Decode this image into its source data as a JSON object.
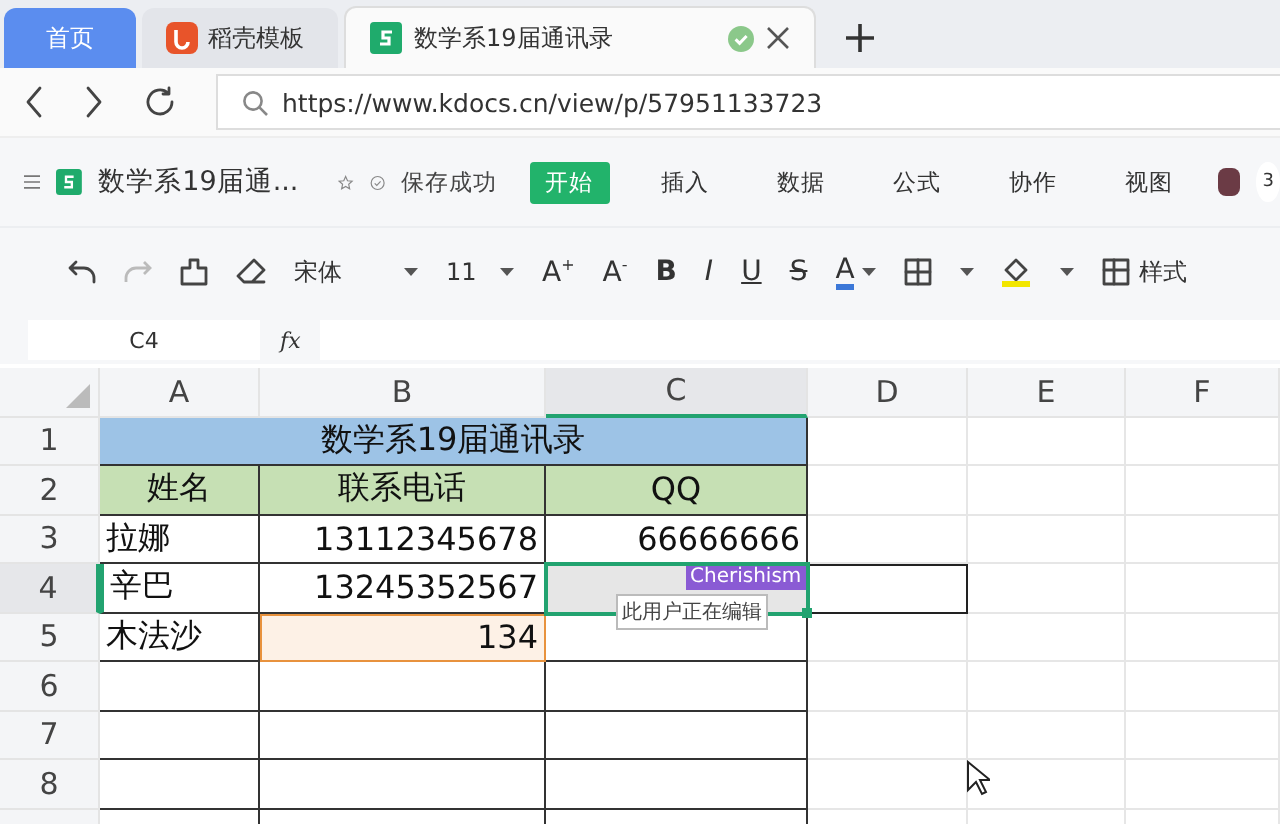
{
  "browser_tabs": [
    {
      "kind": "home",
      "label": "首页",
      "selected": false
    },
    {
      "kind": "template",
      "label": "稻壳模板",
      "selected": false
    },
    {
      "kind": "sheet",
      "label": "数学系19届通讯录",
      "selected": true,
      "saved": true
    }
  ],
  "address_bar": {
    "url": "https://www.kdocs.cn/view/p/57951133723"
  },
  "app_header": {
    "title": "数学系19届通...",
    "save_status": "保存成功",
    "collaborator_count": "3",
    "menu_tabs": [
      {
        "label": "开始",
        "selected": true
      },
      {
        "label": "插入",
        "selected": false
      },
      {
        "label": "数据",
        "selected": false
      },
      {
        "label": "公式",
        "selected": false
      },
      {
        "label": "协作",
        "selected": false
      },
      {
        "label": "视图",
        "selected": false
      }
    ]
  },
  "toolbar": {
    "font": "宋体",
    "size": "11",
    "grow_font": "A$^{+}$",
    "shrink_font": "A$^{-}$",
    "format_buttons": [
      {
        "kind": "bold",
        "label": "B"
      },
      {
        "kind": "italic",
        "label": "I"
      },
      {
        "kind": "underline",
        "label": "U"
      },
      {
        "kind": "strike",
        "label": "S"
      }
    ],
    "font_color_label": "A",
    "styles_label": "样式"
  },
  "formula_bar": {
    "cell_ref": "C4",
    "fx": "fx"
  },
  "sheet": {
    "columns": [
      {
        "label": "A",
        "selected": false
      },
      {
        "label": "B",
        "selected": false
      },
      {
        "label": "C",
        "selected": true
      },
      {
        "label": "D",
        "selected": false
      },
      {
        "label": "E",
        "selected": false
      },
      {
        "label": "F",
        "selected": false
      }
    ],
    "title_row_number": "1",
    "header_row_number": "2",
    "title": "数学系19届通讯录",
    "headers": [
      "姓名",
      "联系电话",
      "QQ"
    ],
    "rows": [
      {
        "number": "3",
        "selected": false,
        "cells": [
          {
            "text": "拉娜",
            "remote_edit": false
          },
          {
            "text": "13112345678",
            "remote_edit": false
          },
          {
            "text": "66666666",
            "remote_edit": false
          }
        ]
      },
      {
        "number": "4",
        "selected": true,
        "cells": [
          {
            "text": "辛巴",
            "remote_edit": false
          },
          {
            "text": "13245352567",
            "remote_edit": false
          },
          {
            "text": "",
            "remote_edit": false
          }
        ]
      },
      {
        "number": "5",
        "selected": false,
        "cells": [
          {
            "text": "木法沙",
            "remote_edit": false
          },
          {
            "text": "134",
            "remote_edit": true
          },
          {
            "text": "",
            "remote_edit": false
          }
        ]
      },
      {
        "number": "6",
        "selected": false,
        "cells": []
      },
      {
        "number": "7",
        "selected": false,
        "cells": []
      },
      {
        "number": "8",
        "selected": false,
        "cells": []
      }
    ],
    "collaborator_tag": "Cherishism",
    "editing_tooltip": "此用户正在编辑"
  }
}
